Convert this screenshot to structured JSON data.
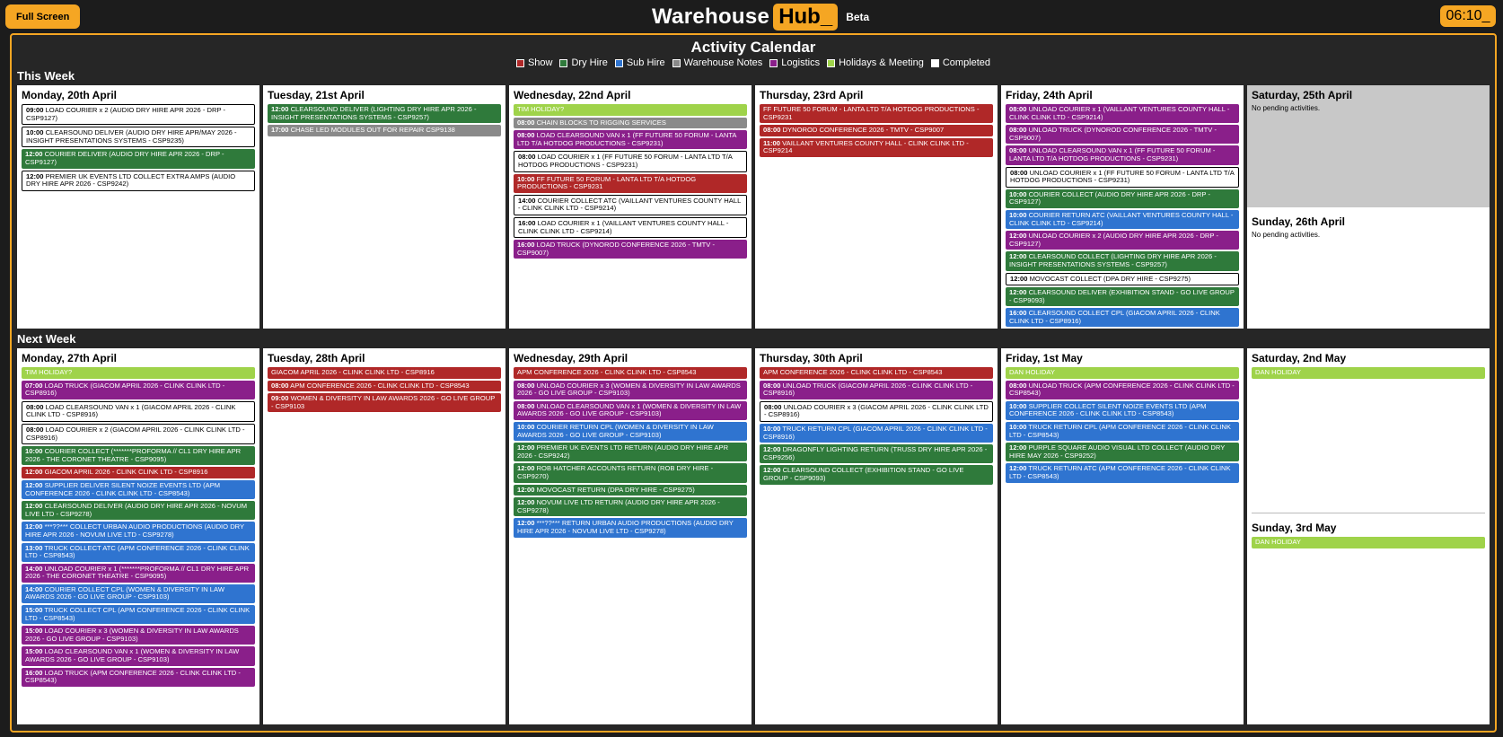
{
  "header": {
    "full_screen_label": "Full Screen",
    "logo_part1": "Warehouse",
    "logo_part2": "Hub_",
    "beta_label": "Beta",
    "clock": "06:10_"
  },
  "calendar": {
    "title": "Activity Calendar",
    "legend": [
      {
        "label": "Show",
        "color": "#b02828"
      },
      {
        "label": "Dry Hire",
        "color": "#2f7a3b"
      },
      {
        "label": "Sub Hire",
        "color": "#2f74d0"
      },
      {
        "label": "Warehouse Notes",
        "color": "#8a8a8a"
      },
      {
        "label": "Logistics",
        "color": "#8a1f8a"
      },
      {
        "label": "Holidays & Meeting",
        "color": "#9fd34a"
      },
      {
        "label": "Completed",
        "color": "#ffffff"
      }
    ],
    "this_week_label": "This Week",
    "next_week_label": "Next Week",
    "empty_text": "No pending activities.",
    "this_week": [
      {
        "title": "Monday, 20th April",
        "events": [
          {
            "time": "09:00",
            "text": "LOAD COURIER x 2 (AUDIO DRY HIRE APR 2026 - DRP - CSP9127)",
            "type": "done"
          },
          {
            "time": "10:00",
            "text": "CLEARSOUND DELIVER (AUDIO DRY HIRE APR/MAY 2026 - INSIGHT PRESENTATIONS SYSTEMS - CSP9235)",
            "type": "done"
          },
          {
            "time": "12:00",
            "text": "COURIER DELIVER (AUDIO DRY HIRE APR 2026 - DRP - CSP9127)",
            "type": "dry"
          },
          {
            "time": "12:00",
            "text": "PREMIER UK EVENTS LTD COLLECT EXTRA AMPS (AUDIO DRY HIRE APR 2026 - CSP9242)",
            "type": "done"
          }
        ]
      },
      {
        "title": "Tuesday, 21st April",
        "events": [
          {
            "time": "12:00",
            "text": "CLEARSOUND DELIVER (LIGHTING DRY HIRE APR 2026 - INSIGHT PRESENTATIONS SYSTEMS - CSP9257)",
            "type": "dry"
          },
          {
            "time": "17:00",
            "text": "CHASE LED MODULES OUT FOR REPAIR CSP9138",
            "type": "notes"
          }
        ]
      },
      {
        "title": "Wednesday, 22nd April",
        "events": [
          {
            "time": "",
            "text": "TIM HOLIDAY?",
            "type": "hol"
          },
          {
            "time": "08:00",
            "text": "CHAIN BLOCKS TO RIGGING SERVICES",
            "type": "notes"
          },
          {
            "time": "08:00",
            "text": "LOAD CLEARSOUND VAN x 1 (FF FUTURE 50 FORUM - LANTA LTD T/A HOTDOG PRODUCTIONS - CSP9231)",
            "type": "log"
          },
          {
            "time": "08:00",
            "text": "LOAD COURIER x 1 (FF FUTURE 50 FORUM - LANTA LTD T/A HOTDOG PRODUCTIONS - CSP9231)",
            "type": "done"
          },
          {
            "time": "10:00",
            "text": "FF FUTURE 50 FORUM - LANTA LTD T/A HOTDOG PRODUCTIONS - CSP9231",
            "type": "show"
          },
          {
            "time": "14:00",
            "text": "COURIER COLLECT ATC (VAILLANT VENTURES COUNTY HALL - CLINK CLINK LTD - CSP9214)",
            "type": "done"
          },
          {
            "time": "16:00",
            "text": "LOAD COURIER x 1 (VAILLANT VENTURES COUNTY HALL - CLINK CLINK LTD - CSP9214)",
            "type": "done"
          },
          {
            "time": "16:00",
            "text": "LOAD TRUCK (DYNOROD CONFERENCE 2026 - TMTV - CSP9007)",
            "type": "log"
          }
        ]
      },
      {
        "title": "Thursday, 23rd April",
        "events": [
          {
            "time": "",
            "text": "FF FUTURE 50 FORUM - LANTA LTD T/A HOTDOG PRODUCTIONS - CSP9231",
            "type": "show"
          },
          {
            "time": "08:00",
            "text": "DYNOROD CONFERENCE 2026 - TMTV - CSP9007",
            "type": "show"
          },
          {
            "time": "11:00",
            "text": "VAILLANT VENTURES COUNTY HALL - CLINK CLINK LTD - CSP9214",
            "type": "show"
          }
        ]
      },
      {
        "title": "Friday, 24th April",
        "events": [
          {
            "time": "08:00",
            "text": "UNLOAD COURIER x 1 (VAILLANT VENTURES COUNTY HALL - CLINK CLINK LTD - CSP9214)",
            "type": "log"
          },
          {
            "time": "08:00",
            "text": "UNLOAD TRUCK (DYNOROD CONFERENCE 2026 - TMTV - CSP9007)",
            "type": "log"
          },
          {
            "time": "08:00",
            "text": "UNLOAD CLEARSOUND VAN x 1 (FF FUTURE 50 FORUM - LANTA LTD T/A HOTDOG PRODUCTIONS - CSP9231)",
            "type": "log"
          },
          {
            "time": "08:00",
            "text": "UNLOAD COURIER x 1 (FF FUTURE 50 FORUM - LANTA LTD T/A HOTDOG PRODUCTIONS - CSP9231)",
            "type": "done"
          },
          {
            "time": "10:00",
            "text": "COURIER COLLECT (AUDIO DRY HIRE APR 2026 - DRP - CSP9127)",
            "type": "dry"
          },
          {
            "time": "10:00",
            "text": "COURIER RETURN ATC (VAILLANT VENTURES COUNTY HALL - CLINK CLINK LTD - CSP9214)",
            "type": "sub"
          },
          {
            "time": "12:00",
            "text": "UNLOAD COURIER x 2 (AUDIO DRY HIRE APR 2026 - DRP - CSP9127)",
            "type": "log"
          },
          {
            "time": "12:00",
            "text": "CLEARSOUND COLLECT (LIGHTING DRY HIRE APR 2026 - INSIGHT PRESENTATIONS SYSTEMS - CSP9257)",
            "type": "dry"
          },
          {
            "time": "12:00",
            "text": "MOVOCAST COLLECT (DPA DRY HIRE - CSP9275)",
            "type": "done"
          },
          {
            "time": "12:00",
            "text": "CLEARSOUND DELIVER (EXHIBITION STAND - GO LIVE GROUP - CSP9093)",
            "type": "dry"
          },
          {
            "time": "16:00",
            "text": "CLEARSOUND COLLECT CPL (GIACOM APRIL 2026 - CLINK CLINK LTD - CSP8916)",
            "type": "sub"
          }
        ]
      },
      {
        "title": "Saturday, 25th April",
        "sunday_title": "Sunday, 26th April",
        "events": [],
        "sunday_events": []
      }
    ],
    "next_week": [
      {
        "title": "Monday, 27th April",
        "events": [
          {
            "time": "",
            "text": "TIM HOLIDAY?",
            "type": "hol"
          },
          {
            "time": "07:00",
            "text": "LOAD TRUCK (GIACOM APRIL 2026 - CLINK CLINK LTD - CSP8916)",
            "type": "log"
          },
          {
            "time": "08:00",
            "text": "LOAD CLEARSOUND VAN x 1 (GIACOM APRIL 2026 - CLINK CLINK LTD - CSP8916)",
            "type": "done"
          },
          {
            "time": "08:00",
            "text": "LOAD COURIER x 2 (GIACOM APRIL 2026 - CLINK CLINK LTD - CSP8916)",
            "type": "done"
          },
          {
            "time": "10:00",
            "text": "COURIER COLLECT (*******PROFORMA // CL1 DRY HIRE APR 2026 - THE CORONET THEATRE - CSP9095)",
            "type": "dry"
          },
          {
            "time": "12:00",
            "text": "GIACOM APRIL 2026 - CLINK CLINK LTD - CSP8916",
            "type": "show"
          },
          {
            "time": "12:00",
            "text": "SUPPLIER DELIVER SILENT NOIZE EVENTS LTD (APM CONFERENCE 2026 - CLINK CLINK LTD - CSP8543)",
            "type": "sub"
          },
          {
            "time": "12:00",
            "text": "CLEARSOUND DELIVER (AUDIO DRY HIRE APR 2026 - NOVUM LIVE LTD - CSP9278)",
            "type": "dry"
          },
          {
            "time": "12:00",
            "text": "***??*** COLLECT URBAN AUDIO PRODUCTIONS (AUDIO DRY HIRE APR 2026 - NOVUM LIVE LTD - CSP9278)",
            "type": "sub"
          },
          {
            "time": "13:00",
            "text": "TRUCK COLLECT ATC (APM CONFERENCE 2026 - CLINK CLINK LTD - CSP8543)",
            "type": "sub"
          },
          {
            "time": "14:00",
            "text": "UNLOAD COURIER x 1 (*******PROFORMA // CL1 DRY HIRE APR 2026 - THE CORONET THEATRE - CSP9095)",
            "type": "log"
          },
          {
            "time": "14:00",
            "text": "COURIER COLLECT CPL (WOMEN & DIVERSITY IN LAW AWARDS 2026 - GO LIVE GROUP - CSP9103)",
            "type": "sub"
          },
          {
            "time": "15:00",
            "text": "TRUCK COLLECT CPL (APM CONFERENCE 2026 - CLINK CLINK LTD - CSP8543)",
            "type": "sub"
          },
          {
            "time": "15:00",
            "text": "LOAD COURIER x 3 (WOMEN & DIVERSITY IN LAW AWARDS 2026 - GO LIVE GROUP - CSP9103)",
            "type": "log"
          },
          {
            "time": "15:00",
            "text": "LOAD CLEARSOUND VAN x 1 (WOMEN & DIVERSITY IN LAW AWARDS 2026 - GO LIVE GROUP - CSP9103)",
            "type": "log"
          },
          {
            "time": "16:00",
            "text": "LOAD TRUCK (APM CONFERENCE 2026 - CLINK CLINK LTD - CSP8543)",
            "type": "log"
          }
        ]
      },
      {
        "title": "Tuesday, 28th April",
        "events": [
          {
            "time": "",
            "text": "GIACOM APRIL 2026 - CLINK CLINK LTD - CSP8916",
            "type": "show"
          },
          {
            "time": "08:00",
            "text": "APM CONFERENCE 2026 - CLINK CLINK LTD - CSP8543",
            "type": "show"
          },
          {
            "time": "09:00",
            "text": "WOMEN & DIVERSITY IN LAW AWARDS 2026 - GO LIVE GROUP - CSP9103",
            "type": "show"
          }
        ]
      },
      {
        "title": "Wednesday, 29th April",
        "events": [
          {
            "time": "",
            "text": "APM CONFERENCE 2026 - CLINK CLINK LTD - CSP8543",
            "type": "show"
          },
          {
            "time": "08:00",
            "text": "UNLOAD COURIER x 3 (WOMEN & DIVERSITY IN LAW AWARDS 2026 - GO LIVE GROUP - CSP9103)",
            "type": "log"
          },
          {
            "time": "08:00",
            "text": "UNLOAD CLEARSOUND VAN x 1 (WOMEN & DIVERSITY IN LAW AWARDS 2026 - GO LIVE GROUP - CSP9103)",
            "type": "log"
          },
          {
            "time": "10:00",
            "text": "COURIER RETURN CPL (WOMEN & DIVERSITY IN LAW AWARDS 2026 - GO LIVE GROUP - CSP9103)",
            "type": "sub"
          },
          {
            "time": "12:00",
            "text": "PREMIER UK EVENTS LTD RETURN (AUDIO DRY HIRE APR 2026 - CSP9242)",
            "type": "dry"
          },
          {
            "time": "12:00",
            "text": "ROB HATCHER ACCOUNTS RETURN (ROB DRY HIRE - CSP9270)",
            "type": "dry"
          },
          {
            "time": "12:00",
            "text": "MOVOCAST RETURN (DPA DRY HIRE - CSP9275)",
            "type": "dry"
          },
          {
            "time": "12:00",
            "text": "NOVUM LIVE LTD RETURN (AUDIO DRY HIRE APR 2026 - CSP9278)",
            "type": "dry"
          },
          {
            "time": "12:00",
            "text": "***??*** RETURN URBAN AUDIO PRODUCTIONS (AUDIO DRY HIRE APR 2026 - NOVUM LIVE LTD - CSP9278)",
            "type": "sub"
          }
        ]
      },
      {
        "title": "Thursday, 30th April",
        "events": [
          {
            "time": "",
            "text": "APM CONFERENCE 2026 - CLINK CLINK LTD - CSP8543",
            "type": "show"
          },
          {
            "time": "08:00",
            "text": "UNLOAD TRUCK (GIACOM APRIL 2026 - CLINK CLINK LTD - CSP8916)",
            "type": "log"
          },
          {
            "time": "08:00",
            "text": "UNLOAD COURIER x 3 (GIACOM APRIL 2026 - CLINK CLINK LTD - CSP8916)",
            "type": "done"
          },
          {
            "time": "10:00",
            "text": "TRUCK RETURN CPL (GIACOM APRIL 2026 - CLINK CLINK LTD - CSP8916)",
            "type": "sub"
          },
          {
            "time": "12:00",
            "text": "DRAGONFLY LIGHTING RETURN (TRUSS DRY HIRE APR 2026 - CSP9256)",
            "type": "dry"
          },
          {
            "time": "12:00",
            "text": "CLEARSOUND COLLECT (EXHIBITION STAND - GO LIVE GROUP - CSP9093)",
            "type": "dry"
          }
        ]
      },
      {
        "title": "Friday, 1st May",
        "events": [
          {
            "time": "",
            "text": "DAN HOLIDAY",
            "type": "hol"
          },
          {
            "time": "08:00",
            "text": "UNLOAD TRUCK (APM CONFERENCE 2026 - CLINK CLINK LTD - CSP8543)",
            "type": "log"
          },
          {
            "time": "10:00",
            "text": "SUPPLIER COLLECT SILENT NOIZE EVENTS LTD (APM CONFERENCE 2026 - CLINK CLINK LTD - CSP8543)",
            "type": "sub"
          },
          {
            "time": "10:00",
            "text": "TRUCK RETURN CPL (APM CONFERENCE 2026 - CLINK CLINK LTD - CSP8543)",
            "type": "sub"
          },
          {
            "time": "12:00",
            "text": "PURPLE SQUARE AUDIO VISUAL LTD COLLECT (AUDIO DRY HIRE MAY 2026 - CSP9252)",
            "type": "dry"
          },
          {
            "time": "12:00",
            "text": "TRUCK RETURN ATC (APM CONFERENCE 2026 - CLINK CLINK LTD - CSP8543)",
            "type": "sub"
          }
        ]
      },
      {
        "title": "Saturday, 2nd May",
        "sunday_title": "Sunday, 3rd May",
        "events": [
          {
            "time": "",
            "text": "DAN HOLIDAY",
            "type": "hol"
          }
        ],
        "sunday_events": [
          {
            "time": "",
            "text": "DAN HOLIDAY",
            "type": "hol"
          }
        ]
      }
    ]
  }
}
